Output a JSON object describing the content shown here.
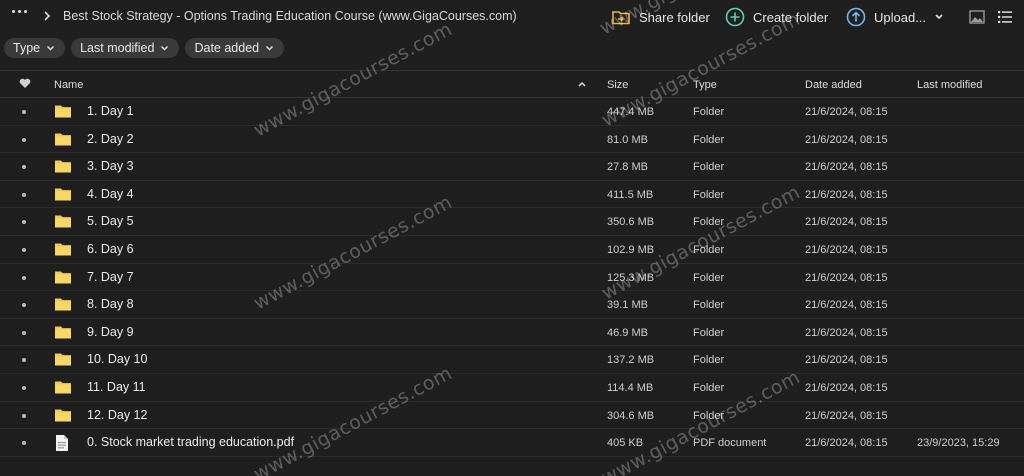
{
  "breadcrumb": {
    "title": "Best Stock Strategy - Options Trading Education Course (www.GigaCourses.com)"
  },
  "toolbar": {
    "share_label": "Share folder",
    "create_label": "Create folder",
    "upload_label": "Upload...",
    "accent_share": "#f2b632",
    "accent_create": "#5ad1b4",
    "accent_upload": "#6fb8f0"
  },
  "filters": [
    "Type",
    "Last modified",
    "Date added"
  ],
  "columns": {
    "name": "Name",
    "size": "Size",
    "type": "Type",
    "added": "Date added",
    "modified": "Last modified"
  },
  "rows": [
    {
      "name": "1. Day 1",
      "size": "447.4 MB",
      "type": "Folder",
      "added": "21/6/2024, 08:15",
      "modified": "",
      "icon": "folder-icon"
    },
    {
      "name": "2. Day 2",
      "size": "81.0 MB",
      "type": "Folder",
      "added": "21/6/2024, 08:15",
      "modified": "",
      "icon": "folder-icon"
    },
    {
      "name": "3. Day 3",
      "size": "27.8 MB",
      "type": "Folder",
      "added": "21/6/2024, 08:15",
      "modified": "",
      "icon": "folder-icon"
    },
    {
      "name": "4. Day 4",
      "size": "411.5 MB",
      "type": "Folder",
      "added": "21/6/2024, 08:15",
      "modified": "",
      "icon": "folder-icon"
    },
    {
      "name": "5. Day 5",
      "size": "350.6 MB",
      "type": "Folder",
      "added": "21/6/2024, 08:15",
      "modified": "",
      "icon": "folder-icon"
    },
    {
      "name": "6. Day 6",
      "size": "102.9 MB",
      "type": "Folder",
      "added": "21/6/2024, 08:15",
      "modified": "",
      "icon": "folder-icon"
    },
    {
      "name": "7. Day 7",
      "size": "125.3 MB",
      "type": "Folder",
      "added": "21/6/2024, 08:15",
      "modified": "",
      "icon": "folder-icon"
    },
    {
      "name": "8. Day 8",
      "size": "39.1 MB",
      "type": "Folder",
      "added": "21/6/2024, 08:15",
      "modified": "",
      "icon": "folder-icon"
    },
    {
      "name": "9. Day 9",
      "size": "46.9 MB",
      "type": "Folder",
      "added": "21/6/2024, 08:15",
      "modified": "",
      "icon": "folder-icon"
    },
    {
      "name": "10. Day 10",
      "size": "137.2 MB",
      "type": "Folder",
      "added": "21/6/2024, 08:15",
      "modified": "",
      "icon": "folder-icon"
    },
    {
      "name": "11. Day 11",
      "size": "114.4 MB",
      "type": "Folder",
      "added": "21/6/2024, 08:15",
      "modified": "",
      "icon": "folder-icon"
    },
    {
      "name": "12. Day 12",
      "size": "304.6 MB",
      "type": "Folder",
      "added": "21/6/2024, 08:15",
      "modified": "",
      "icon": "folder-icon"
    },
    {
      "name": "0. Stock market trading education.pdf",
      "size": "405 KB",
      "type": "PDF document",
      "added": "21/6/2024, 08:15",
      "modified": "23/9/2023, 15:29",
      "icon": "pdf-file-icon"
    }
  ],
  "watermark": "www.gigacourses.com"
}
